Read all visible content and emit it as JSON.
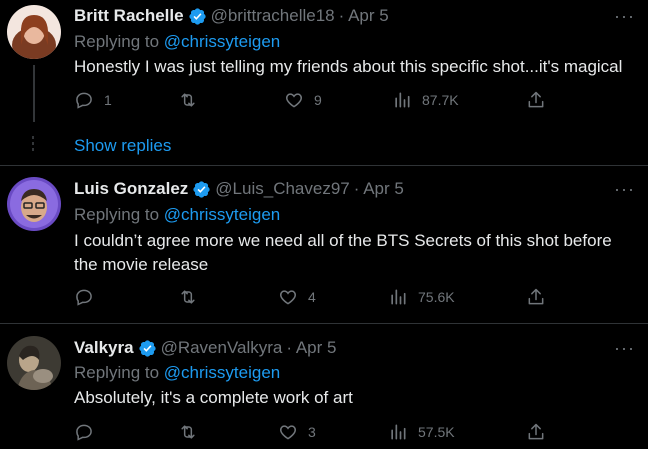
{
  "tweets": [
    {
      "name": "Britt Rachelle",
      "handle": "@brittrachelle18",
      "date": "· Apr 5",
      "replying_prefix": "Replying to ",
      "replying_handle": "@chrissyteigen",
      "text": "Honestly I was just telling my friends about this specific shot...it's magical",
      "replies": "1",
      "retweets": "",
      "likes": "9",
      "views": "87.7K"
    },
    {
      "name": "Luis Gonzalez",
      "handle": "@Luis_Chavez97",
      "date": "· Apr 5",
      "replying_prefix": "Replying to ",
      "replying_handle": "@chrissyteigen",
      "text": "I couldn’t agree more we need all of the BTS Secrets of this shot before the movie release",
      "replies": "",
      "retweets": "",
      "likes": "4",
      "views": "75.6K"
    },
    {
      "name": "Valkyra",
      "handle": "@RavenValkyra",
      "date": "· Apr 5",
      "replying_prefix": "Replying to ",
      "replying_handle": "@chrissyteigen",
      "text": "Absolutely, it's a complete work of art",
      "replies": "",
      "retweets": "",
      "likes": "3",
      "views": "57.5K"
    }
  ],
  "show_replies": "Show replies",
  "more_glyph": "···",
  "colors": {
    "accent": "#1d9bf0",
    "muted": "#71767b",
    "text": "#e7e9ea",
    "bg": "#000000"
  },
  "icons": [
    "reply-icon",
    "retweet-icon",
    "like-icon",
    "views-icon",
    "share-icon",
    "verified-badge-icon",
    "more-icon"
  ]
}
